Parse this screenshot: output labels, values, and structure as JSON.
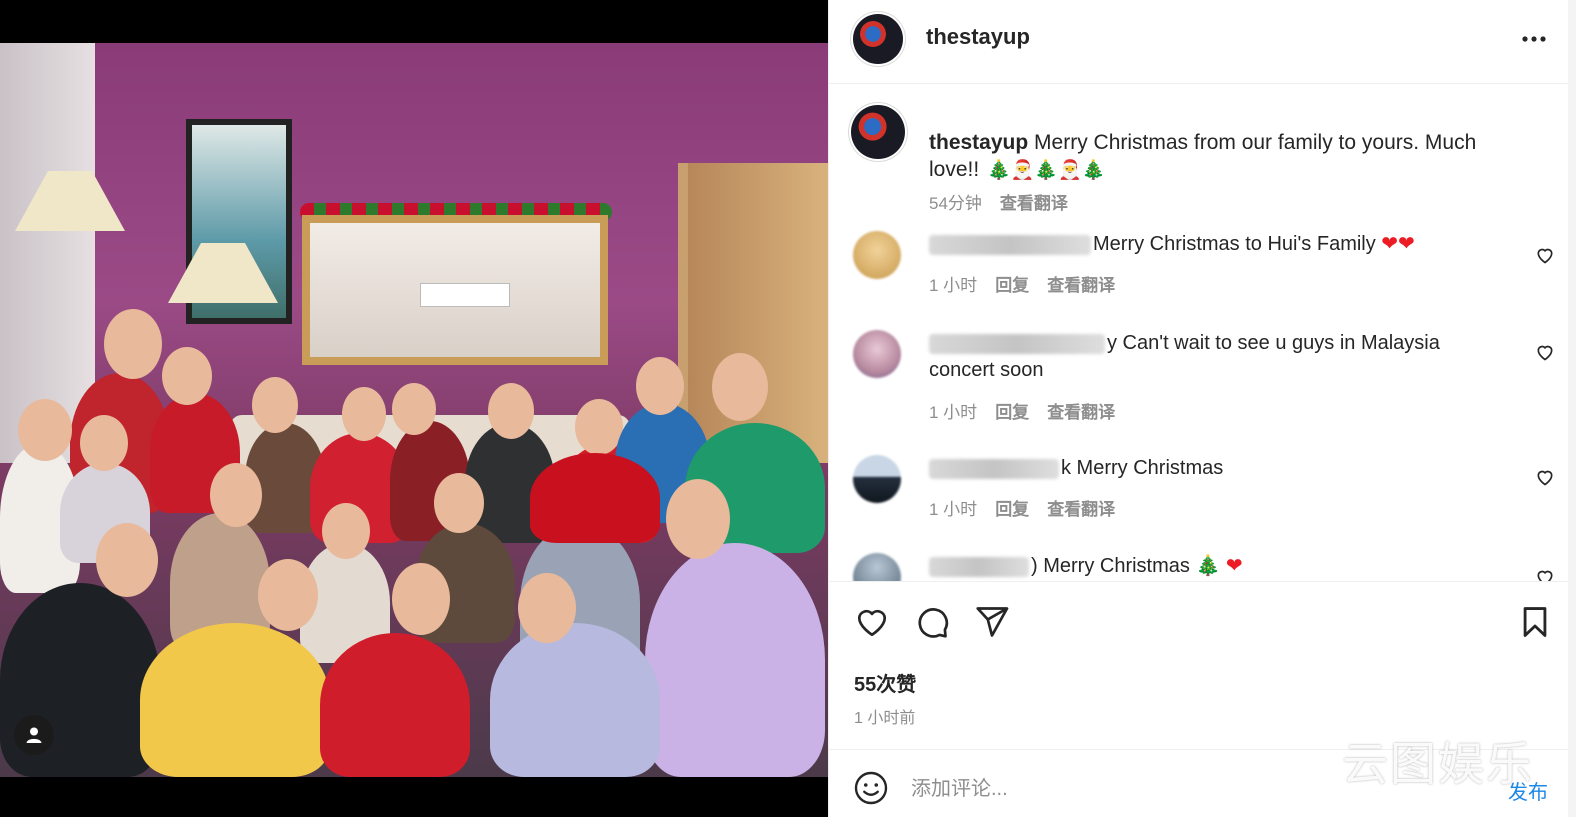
{
  "post": {
    "username": "thestayup",
    "caption_username": "thestayup",
    "caption_text": "Merry Christmas from our family to yours. Much love!!",
    "caption_emojis": "🎄🎅🎄🎅🎄",
    "caption_time": "54分钟",
    "caption_translate": "查看翻译"
  },
  "comments": [
    {
      "text": "Merry Christmas to Hui's Family",
      "emojis": "❤❤",
      "time": "1 小时",
      "reply": "回复",
      "translate": "查看翻译"
    },
    {
      "text": "y Can't wait to see u guys in Malaysia concert soon",
      "emojis": "",
      "time": "1 小时",
      "reply": "回复",
      "translate": "查看翻译"
    },
    {
      "text": "k Merry Christmas",
      "emojis": "",
      "time": "1 小时",
      "reply": "回复",
      "translate": "查看翻译"
    },
    {
      "text": ") Merry Christmas",
      "emojis": "🎄 ❤",
      "time": "",
      "reply": "",
      "translate": ""
    }
  ],
  "actions": {
    "likes": "55次赞",
    "posted": "1 小时前"
  },
  "add_comment": {
    "placeholder": "添加评论..."
  },
  "watermark": {
    "main": "云图娱乐",
    "sub": "发布"
  },
  "icons": {
    "more": "more-horizontal-icon",
    "like": "heart-icon",
    "comment": "comment-bubble-icon",
    "share": "paper-plane-icon",
    "save": "bookmark-icon",
    "emoji": "smiley-icon",
    "user_tag": "person-icon"
  },
  "colors": {
    "text": "#262626",
    "muted": "#8e8e8e",
    "divider": "#efefef",
    "like_red": "#ed1c24"
  }
}
